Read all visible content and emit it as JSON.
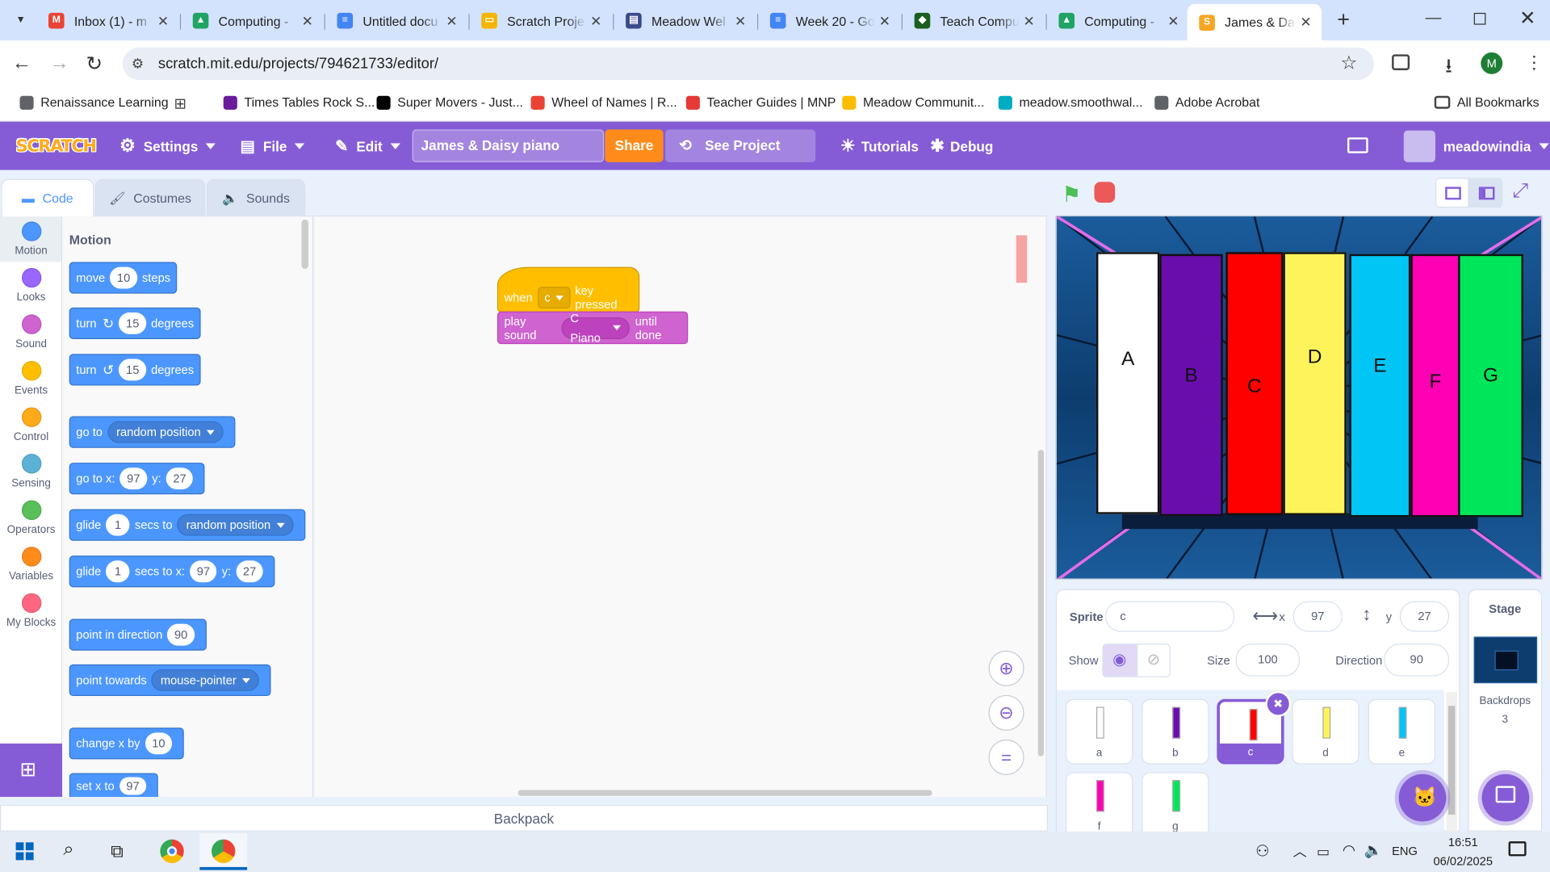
{
  "browser": {
    "tabs": [
      {
        "title": "Inbox (1) - m",
        "color": "#ea4335",
        "icon": "gmail-icon",
        "ic": "M"
      },
      {
        "title": "Computing -",
        "color": "#1fa463",
        "icon": "drive-icon",
        "ic": "▲"
      },
      {
        "title": "Untitled docu",
        "color": "#4285f4",
        "icon": "docs-icon",
        "ic": "≡"
      },
      {
        "title": "Scratch Proje",
        "color": "#f4b400",
        "icon": "slides-icon",
        "ic": "▭"
      },
      {
        "title": "Meadow Wel",
        "color": "#3c4a8c",
        "icon": "sites-icon",
        "ic": "▤"
      },
      {
        "title": "Week 20 - Go",
        "color": "#4285f4",
        "icon": "docs-icon",
        "ic": "≡"
      },
      {
        "title": "Teach Compu",
        "color": "#1b5e20",
        "icon": "teach-computing-icon",
        "ic": "◆"
      },
      {
        "title": "Computing -",
        "color": "#1fa463",
        "icon": "drive-icon",
        "ic": "▲"
      },
      {
        "title": "James & Dais",
        "color": "#f6a623",
        "icon": "scratch-icon",
        "ic": "S"
      }
    ],
    "url": "scratch.mit.edu/projects/794621733/editor/",
    "profile_initial": "M",
    "bookmarks": [
      "Renaissance Learning",
      "Times Tables Rock S...",
      "Super Movers - Just...",
      "Wheel of Names | R...",
      "Teacher Guides | MNP",
      "Meadow Communit...",
      "meadow.smoothwal...",
      "Adobe Acrobat"
    ],
    "bookmark_colors": [
      "#5f6368",
      "#6a1b9a",
      "#000000",
      "#ea4335",
      "#e53935",
      "#fbbc04",
      "#00acc1",
      "#5f6368"
    ],
    "all_bookmarks": "All Bookmarks"
  },
  "menu": {
    "logo": "SCRATCH",
    "settings": "Settings",
    "file": "File",
    "edit": "Edit",
    "project_title": "James & Daisy piano",
    "share": "Share",
    "see_project": "See Project Page",
    "tutorials": "Tutorials",
    "debug": "Debug",
    "username": "meadowindia"
  },
  "editor_tabs": {
    "code": "Code",
    "costumes": "Costumes",
    "sounds": "Sounds"
  },
  "categories": [
    {
      "name": "Motion",
      "color": "#4c97ff"
    },
    {
      "name": "Looks",
      "color": "#9966ff"
    },
    {
      "name": "Sound",
      "color": "#cf63cf"
    },
    {
      "name": "Events",
      "color": "#ffbf00"
    },
    {
      "name": "Control",
      "color": "#ffab19"
    },
    {
      "name": "Sensing",
      "color": "#5cb1d6"
    },
    {
      "name": "Operators",
      "color": "#59c059"
    },
    {
      "name": "Variables",
      "color": "#ff8c1a"
    },
    {
      "name": "My Blocks",
      "color": "#ff6680"
    }
  ],
  "palette": {
    "heading": "Motion",
    "move": {
      "a": "move",
      "n": "10",
      "b": "steps"
    },
    "turn_right": {
      "a": "turn",
      "n": "15",
      "b": "degrees"
    },
    "turn_left": {
      "a": "turn",
      "n": "15",
      "b": "degrees"
    },
    "goto": {
      "a": "go to",
      "d": "random position"
    },
    "goto_xy": {
      "a": "go to x:",
      "x": "97",
      "b": "y:",
      "y": "27"
    },
    "glide_to": {
      "a": "glide",
      "n": "1",
      "b": "secs to",
      "d": "random position"
    },
    "glide_xy": {
      "a": "glide",
      "n": "1",
      "b": "secs to x:",
      "x": "97",
      "c": "y:",
      "y": "27"
    },
    "point_dir": {
      "a": "point in direction",
      "n": "90"
    },
    "point_towards": {
      "a": "point towards",
      "d": "mouse-pointer"
    },
    "change_x": {
      "a": "change x by",
      "n": "10"
    },
    "set_x": {
      "a": "set x to",
      "n": "97"
    }
  },
  "script": {
    "hat_when": "when",
    "hat_key": "c",
    "hat_pressed": "key pressed",
    "play_sound": "play sound",
    "sound": "C Piano",
    "until_done": "until done"
  },
  "workspace": {
    "backpack": "Backpack"
  },
  "stage_keys": [
    "A",
    "B",
    "C",
    "D",
    "E",
    "F",
    "G"
  ],
  "stage_key_colors": [
    "#ffffff",
    "#6a0dad",
    "#ff0000",
    "#fff35c",
    "#00c5f5",
    "#ff00b4",
    "#00e65a"
  ],
  "sprite_info": {
    "sprite_label": "Sprite",
    "sprite_name": "c",
    "x_label": "x",
    "x": "97",
    "y_label": "y",
    "y": "27",
    "show_label": "Show",
    "size_label": "Size",
    "size": "100",
    "direction_label": "Direction",
    "direction": "90"
  },
  "sprites": [
    {
      "name": "a",
      "color": "#ffffff"
    },
    {
      "name": "b",
      "color": "#6a0dad"
    },
    {
      "name": "c",
      "color": "#ff0000",
      "selected": true
    },
    {
      "name": "d",
      "color": "#fff35c"
    },
    {
      "name": "e",
      "color": "#00c5f5"
    },
    {
      "name": "f",
      "color": "#ff00b4"
    },
    {
      "name": "g",
      "color": "#00e65a"
    }
  ],
  "stage_panel": {
    "title": "Stage",
    "backdrops_label": "Backdrops",
    "backdrops_count": "3"
  },
  "taskbar": {
    "time": "16:51",
    "date": "06/02/2025",
    "lang": "ENG"
  }
}
